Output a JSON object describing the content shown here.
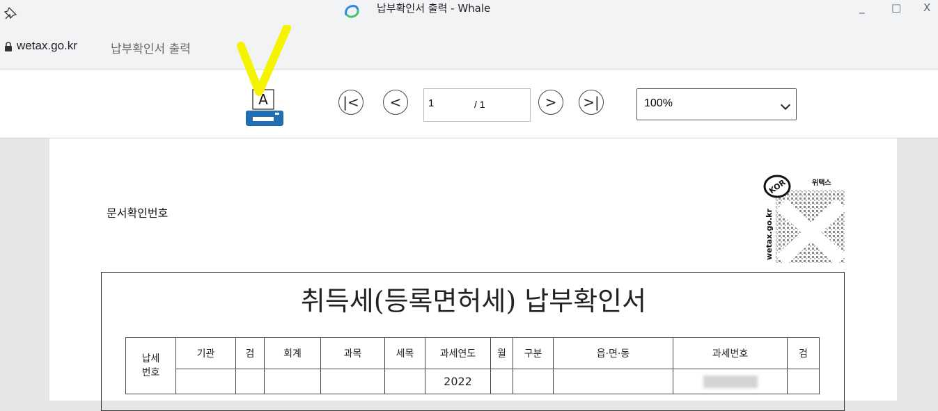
{
  "window": {
    "title": "납부확인서 출력 - Whale",
    "controls": [
      "_",
      "□",
      "X"
    ]
  },
  "address": {
    "domain": "wetax.go.kr",
    "path": "납부확인서 출력"
  },
  "toolbar": {
    "print_icon_letter": "A",
    "nav": {
      "first": "|<",
      "prev": "<",
      "next": ">",
      "last": ">|"
    },
    "page_current": "1",
    "page_total": "/ 1",
    "zoom": "100%"
  },
  "document": {
    "doc_number_label": "문서확인번호",
    "stamp": {
      "badge": "KOR",
      "text": "위택스",
      "site": "wetax.go.kr"
    },
    "title": "취득세(등록면허세) 납부확인서",
    "table": {
      "row_header": "납세\n번호",
      "columns": [
        "기관",
        "검",
        "회계",
        "과목",
        "세목",
        "과세연도",
        "월",
        "구분",
        "읍·면·동",
        "과세번호",
        "검"
      ],
      "values": [
        "",
        "",
        "",
        "",
        "",
        "2022",
        "",
        "",
        "",
        "",
        ""
      ]
    }
  },
  "colors": {
    "printer": "#1f6fb2",
    "annotation": "#f4f400",
    "titlebar": "#f1f3f4"
  }
}
